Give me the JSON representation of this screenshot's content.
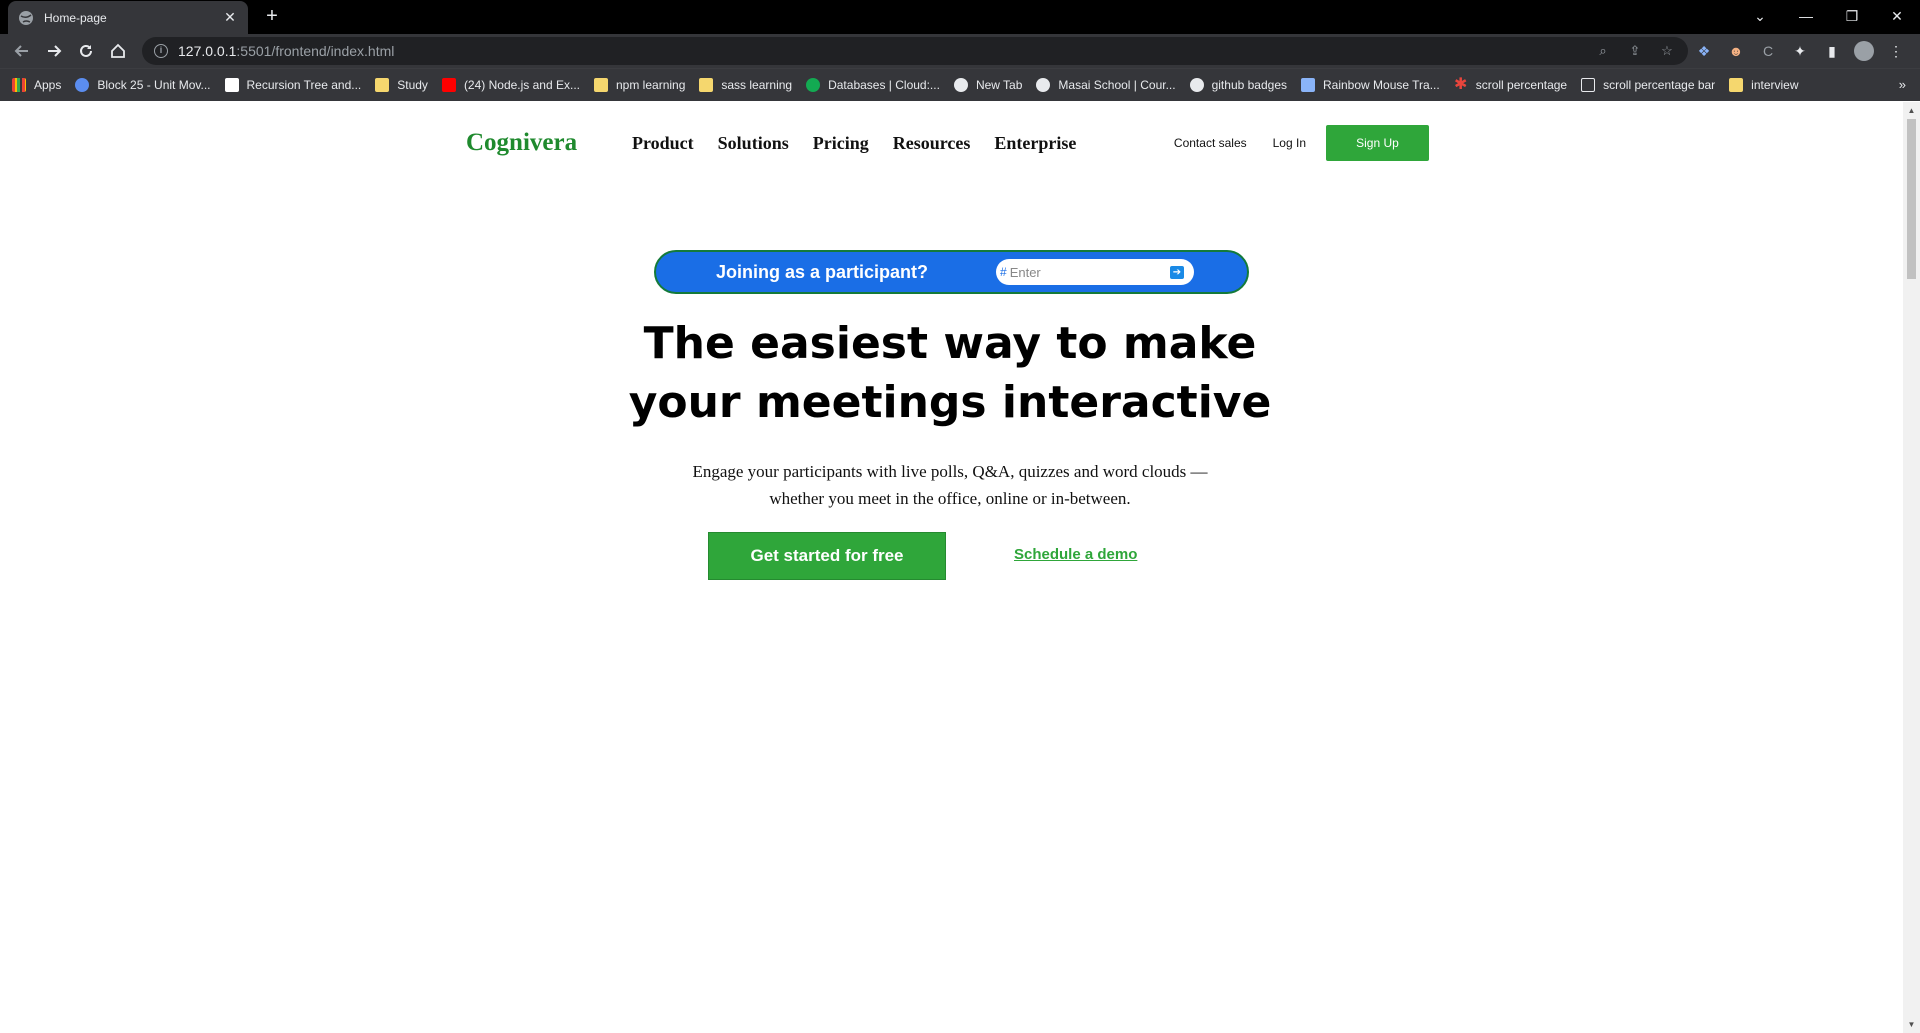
{
  "browser": {
    "tab_title": "Home-page",
    "tab_close": "✕",
    "new_tab": "+",
    "url_host": "127.0.0.1",
    "url_path": ":5501/frontend/index.html",
    "bookmarks": [
      {
        "label": "Apps",
        "color": "#4285f4"
      },
      {
        "label": "Block 25 - Unit Mov...",
        "color": "#5b8def"
      },
      {
        "label": "Recursion Tree and...",
        "color": "#ffffff"
      },
      {
        "label": "Study",
        "color": "#f5d76e"
      },
      {
        "label": "(24) Node.js and Ex...",
        "color": "#ff0000"
      },
      {
        "label": "npm learning",
        "color": "#f5d76e"
      },
      {
        "label": "sass learning",
        "color": "#f5d76e"
      },
      {
        "label": "Databases | Cloud:...",
        "color": "#13aa52"
      },
      {
        "label": "New Tab",
        "color": "#9aa0a6"
      },
      {
        "label": "Masai School | Cour...",
        "color": "#9aa0a6"
      },
      {
        "label": "github badges",
        "color": "#e8eaed"
      },
      {
        "label": "Rainbow Mouse Tra...",
        "color": "#8ab4f8"
      },
      {
        "label": "scroll percentage",
        "color": "#e8453c"
      },
      {
        "label": "scroll percentage bar",
        "color": "#e8eaed"
      },
      {
        "label": "interview",
        "color": "#f5d76e"
      }
    ],
    "bookmarks_more": "»"
  },
  "nav": {
    "logo": "Cognivera",
    "menu": [
      "Product",
      "Solutions",
      "Pricing",
      "Resources",
      "Enterprise"
    ],
    "contact": "Contact sales",
    "login": "Log In",
    "signup": "Sign Up"
  },
  "join": {
    "label": "Joining as a participant?",
    "hash": "#",
    "placeholder": "Enter"
  },
  "hero": {
    "title_line1": "The easiest way to make",
    "title_line2": "your meetings interactive",
    "subtitle": "Engage your participants with live polls, Q&A, quizzes and word clouds — whether you meet in the office, online or in-between.",
    "cta": "Get started for free",
    "demo": "Schedule a demo"
  },
  "colors": {
    "brand_green": "#2fa63a",
    "join_blue": "#1a6ee6"
  }
}
